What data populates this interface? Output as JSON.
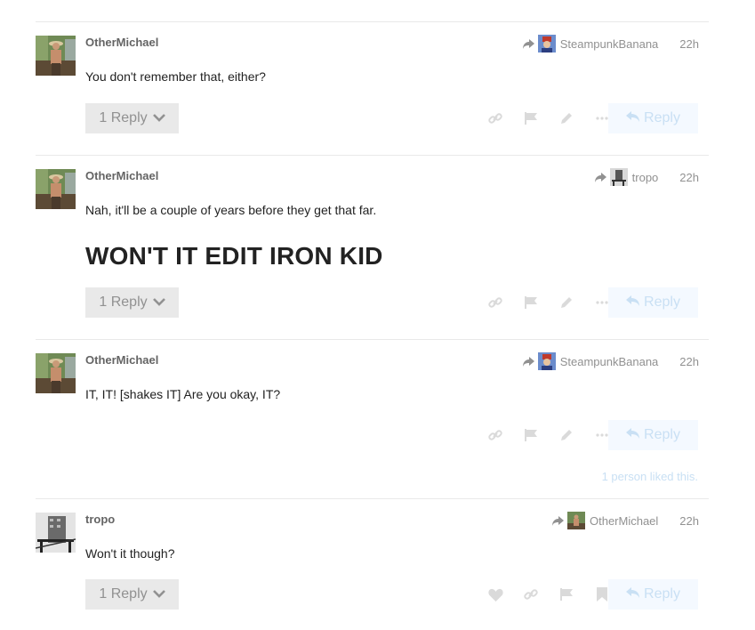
{
  "posts": [
    {
      "username": "OtherMichael",
      "reply_to": "SteampunkBanana",
      "time": "22h",
      "lines": [
        "You don't remember that, either?"
      ],
      "heading": "",
      "replies_label": "1 Reply",
      "reply_label": "Reply",
      "likes_text": ""
    },
    {
      "username": "OtherMichael",
      "reply_to": "tropo",
      "time": "22h",
      "lines": [
        "Nah, it'll be a couple of years before they get that far."
      ],
      "heading": "WON'T IT EDIT IRON KID",
      "replies_label": "1 Reply",
      "reply_label": "Reply",
      "likes_text": ""
    },
    {
      "username": "OtherMichael",
      "reply_to": "SteampunkBanana",
      "time": "22h",
      "lines": [
        "IT, IT! [shakes IT] Are you okay, IT?"
      ],
      "heading": "",
      "replies_label": "",
      "reply_label": "Reply",
      "likes_text": "1 person liked this."
    },
    {
      "username": "tropo",
      "reply_to": "OtherMichael",
      "time": "22h",
      "lines": [
        "Won't it though?"
      ],
      "heading": "",
      "replies_label": "1 Reply",
      "reply_label": "Reply",
      "likes_text": ""
    }
  ],
  "icons": {
    "share": "link-icon",
    "flag": "flag-icon",
    "edit": "pencil-icon",
    "more": "ellipsis-icon",
    "like": "heart-icon",
    "bookmark": "bookmark-icon",
    "reply": "reply-arrow-icon",
    "expand": "chevron-down-icon"
  },
  "colors": {
    "muted_text": "#919191",
    "username": "#646464",
    "button_gray": "#e9e9e9",
    "reply_button_bg": "#f4f9ff",
    "reply_button_text": "#c9e0f4",
    "divider": "#e9e9e9"
  }
}
